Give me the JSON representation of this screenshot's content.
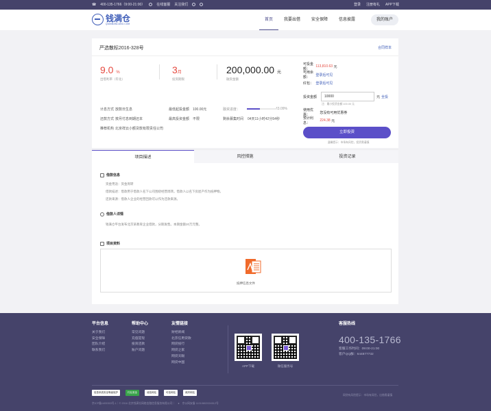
{
  "topbar": {
    "phone": "400-135-1766（9:00-21:00）",
    "service": "在线客服",
    "follow": "关注我们",
    "login": "登录",
    "register": "注册有礼",
    "app": "APP下载"
  },
  "header": {
    "logo_text": "钱满仓",
    "logo_sub": "QIANMANCANG.COM",
    "nav": [
      "首页",
      "我要出借",
      "安全保障",
      "信息披露"
    ],
    "account": "我的账户"
  },
  "product": {
    "title": "严选散标2016-328号",
    "contract_link": "合同样本",
    "rate": "9.0",
    "rate_unit": "%",
    "rate_label": "出借利率（年化）",
    "period": "3",
    "period_unit": "月",
    "period_label": "投资期限",
    "amount": "200,000.00",
    "amount_unit": "元",
    "amount_label": "融资金额",
    "calc_k": "计息方式",
    "calc_v": "放款日生息",
    "min_k": "最低起投金额",
    "min_v": "100.00元",
    "progress_k": "融资进度：",
    "progress_v": "43.09%",
    "progress": 0.4309,
    "repay_k": "还款方式",
    "repay_v": "按月付息到期还本",
    "max_k": "最高投资金额",
    "max_v": "不限",
    "remain_k": "剩余募集时间",
    "remain_v": "04天11小时42分54秒",
    "org_k": "推荐机构",
    "org_v": "北京祥云小额贷款有限责任公司"
  },
  "invest_panel": {
    "investable_k": "可投金额：",
    "investable_v": "113,810.63",
    "investable_unit": "元",
    "available_k": "可用余额：",
    "available_v": "登录后可见",
    "redpacket_k": "红包：",
    "redpacket_v": "登录后可见",
    "invest_k": "投资金额",
    "invest_value": "10000",
    "invest_unit": "元",
    "all_label": "全投",
    "hint": "注：最小投资金额 100.00 元",
    "coupon_k": "使用优惠：",
    "coupon_v": "您没有可用优惠券",
    "expected_k": "预计利息：",
    "expected_v": "224.38",
    "expected_unit": "元",
    "button": "立即投资",
    "risk": "温馨提示：市场有风险，投资需谨慎"
  },
  "tabs": [
    "项目描述",
    "风控措施",
    "投资记录"
  ],
  "detail": {
    "loan_info_title": "借款信息",
    "loan_lines": [
      "资金用途：资金周转",
      "借款描述：借款用于借款人名下公司围绕经营周转。借款人以名下房屋产作为抵押物。",
      "还款来源：借款人企业的经营回款可以作为还款来源。"
    ],
    "borrower_title": "借款人详情",
    "borrower_line": "钱满仓平台发布北京某教育企业借款，分期发售。本期金额20万元整。",
    "files_title": "项目资料",
    "file_label": "抵押信息文件"
  },
  "footer": {
    "col1_title": "平台信息",
    "col1": [
      "关于我们",
      "安全保障",
      "团队介绍",
      "联系我们"
    ],
    "col2_title": "帮助中心",
    "col2": [
      "常见问题",
      "充值提现",
      "投资还款",
      "账户问题"
    ],
    "col3_title": "友情链接",
    "col3": [
      "财经新闻",
      "北京信用贷款",
      "网贷投行",
      "网贷之家",
      "网贷天眼",
      "网贷中国"
    ],
    "qr1_label": "APP下载",
    "qr2_label": "微信服务号",
    "hotline_title": "客服热线",
    "hotline": "400-135-1766",
    "hours": "客服工作时间：09:00-21:00",
    "qq": "客户QQ群：644877732",
    "badges": [
      "信息系统安全等级保护",
      "行业安全",
      "诚信网站",
      "可信网站",
      "政府网站"
    ],
    "copyright": "京ICP备1405353号-1｜© 2016 北京钱满仓网络金融信息服务有限公司｜",
    "police": "京公网安备 11010802024512号",
    "risk": "市场有风险，出借需谨慎",
    "risk_prefix": "网贷有风险提示："
  }
}
